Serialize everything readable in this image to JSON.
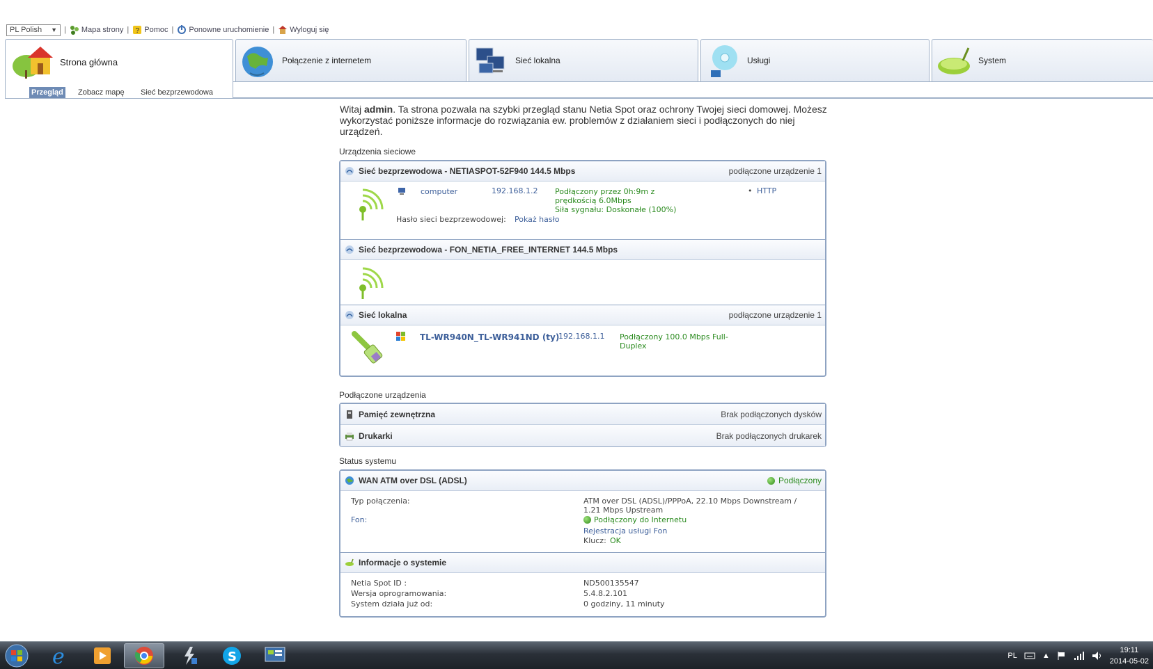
{
  "topbar": {
    "language": "PL Polish",
    "links": [
      "Mapa strony",
      "Pomoc",
      "Ponowne uruchomienie",
      "Wyloguj się"
    ]
  },
  "tabs": [
    {
      "label": "Strona główna"
    },
    {
      "label": "Połączenie z internetem"
    },
    {
      "label": "Sieć lokalna"
    },
    {
      "label": "Usługi"
    },
    {
      "label": "System"
    }
  ],
  "subtabs": [
    "Przegląd",
    "Zobacz mapę",
    "Sieć bezprzewodowa"
  ],
  "intro": {
    "prefix": "Witaj ",
    "user": "admin",
    "rest": ". Ta strona pozwala na szybki przegląd stanu Netia Spot oraz ochrony Twojej sieci domowej. Możesz wykorzystać poniższe informacje do rozwiązania ew. problemów z działaniem sieci i podłączonych do niej urządzeń."
  },
  "network_devices": {
    "title": "Urządzenia sieciowe",
    "wifi1": {
      "header": "Sieć bezprzewodowa - NETIASPOT-52F940 144.5 Mbps",
      "count": "podłączone urządzenie 1",
      "device_name": "computer",
      "ip": "192.168.1.2",
      "status_line1": "Podłączony przez 0h:9m z",
      "status_line2": "prędkością 6.0Mbps",
      "signal": "Siła sygnału: Doskonałe (100%)",
      "service": "HTTP",
      "password_label": "Hasło sieci bezprzewodowej:",
      "password_link": "Pokaż hasło"
    },
    "wifi2": {
      "header": "Sieć bezprzewodowa - FON_NETIA_FREE_INTERNET 144.5 Mbps"
    },
    "lan": {
      "header": "Sieć lokalna",
      "count": "podłączone urządzenie 1",
      "device_name": "TL-WR940N_TL-WR941ND (ty)",
      "ip": "192.168.1.1",
      "status_line1": "Podłączony 100.0 Mbps Full-",
      "status_line2": "Duplex"
    }
  },
  "connected_devices": {
    "title": "Podłączone urządzenia",
    "storage": {
      "header": "Pamięć zewnętrzna",
      "status": "Brak podłączonych dysków"
    },
    "printers": {
      "header": "Drukarki",
      "status": "Brak podłączonych drukarek"
    }
  },
  "system_status": {
    "title": "Status systemu",
    "wan": {
      "header": "WAN ATM over DSL (ADSL)",
      "status": "Podłączony",
      "type_label": "Typ połączenia:",
      "type_value_line1": "ATM over DSL (ADSL)/PPPoA, 22.10 Mbps Downstream /",
      "type_value_line2": "1.21 Mbps Upstream",
      "fon_label": "Fon:",
      "fon_status": "Podłączony do Internetu",
      "fon_link": "Rejestracja usługi Fon",
      "key_label": "Klucz:",
      "key_value": "OK"
    },
    "info": {
      "header": "Informacje o systemie",
      "id_label": "Netia Spot ID :",
      "id_value": "ND500135547",
      "fw_label": "Wersja oprogramowania:",
      "fw_value": "5.4.8.2.101",
      "uptime_label": "System działa już od:",
      "uptime_value": "0 godziny, 11 minuty"
    }
  },
  "taskbar": {
    "lang": "PL",
    "time": "19:11",
    "date": "2014-05-02"
  },
  "colors": {
    "accent": "#8ea3c2",
    "green": "#2a8a1e",
    "link": "#3d5f9a"
  }
}
